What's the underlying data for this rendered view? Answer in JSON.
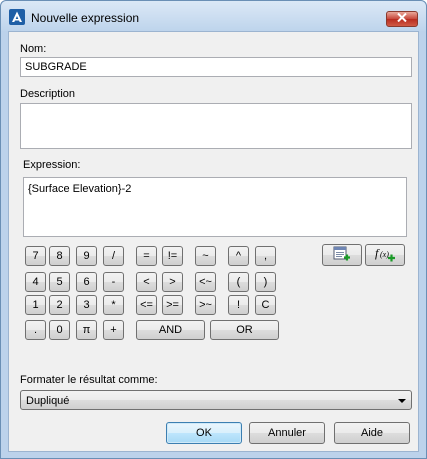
{
  "window": {
    "title": "Nouvelle expression",
    "icon": "autocad-a-icon"
  },
  "nom": {
    "label": "Nom:",
    "value": "SUBGRADE"
  },
  "description": {
    "label": "Description",
    "value": ""
  },
  "expression": {
    "label": "Expression:",
    "value": "{Surface Elevation}-2"
  },
  "calculator": {
    "rows": [
      [
        "7",
        "8",
        "9",
        "/"
      ],
      [
        "4",
        "5",
        "6",
        "-"
      ],
      [
        "1",
        "2",
        "3",
        "*"
      ],
      [
        ".",
        "0",
        "π",
        "+"
      ]
    ],
    "ops_col1": [
      "=",
      "<",
      "<="
    ],
    "ops_col2": [
      "!=",
      ">",
      ">="
    ],
    "ops_col3": [
      "~",
      "<~",
      ">~"
    ],
    "ops_col4": [
      "^",
      "(",
      "!"
    ],
    "ops_col5": [
      ",",
      ")",
      "C"
    ],
    "and_label": "AND",
    "or_label": "OR"
  },
  "tools": {
    "insert_property_icon": "insert-property-icon",
    "insert_function_icon": "insert-function-icon"
  },
  "format": {
    "label": "Formater le résultat comme:",
    "selected": "Dupliqué"
  },
  "buttons": {
    "ok": "OK",
    "cancel": "Annuler",
    "help": "Aide"
  },
  "colors": {
    "title_bg": "#bed4ec",
    "close_red": "#c7463a",
    "default_button_border": "#3c7fb1",
    "client_bg": "#f0f0f0"
  }
}
